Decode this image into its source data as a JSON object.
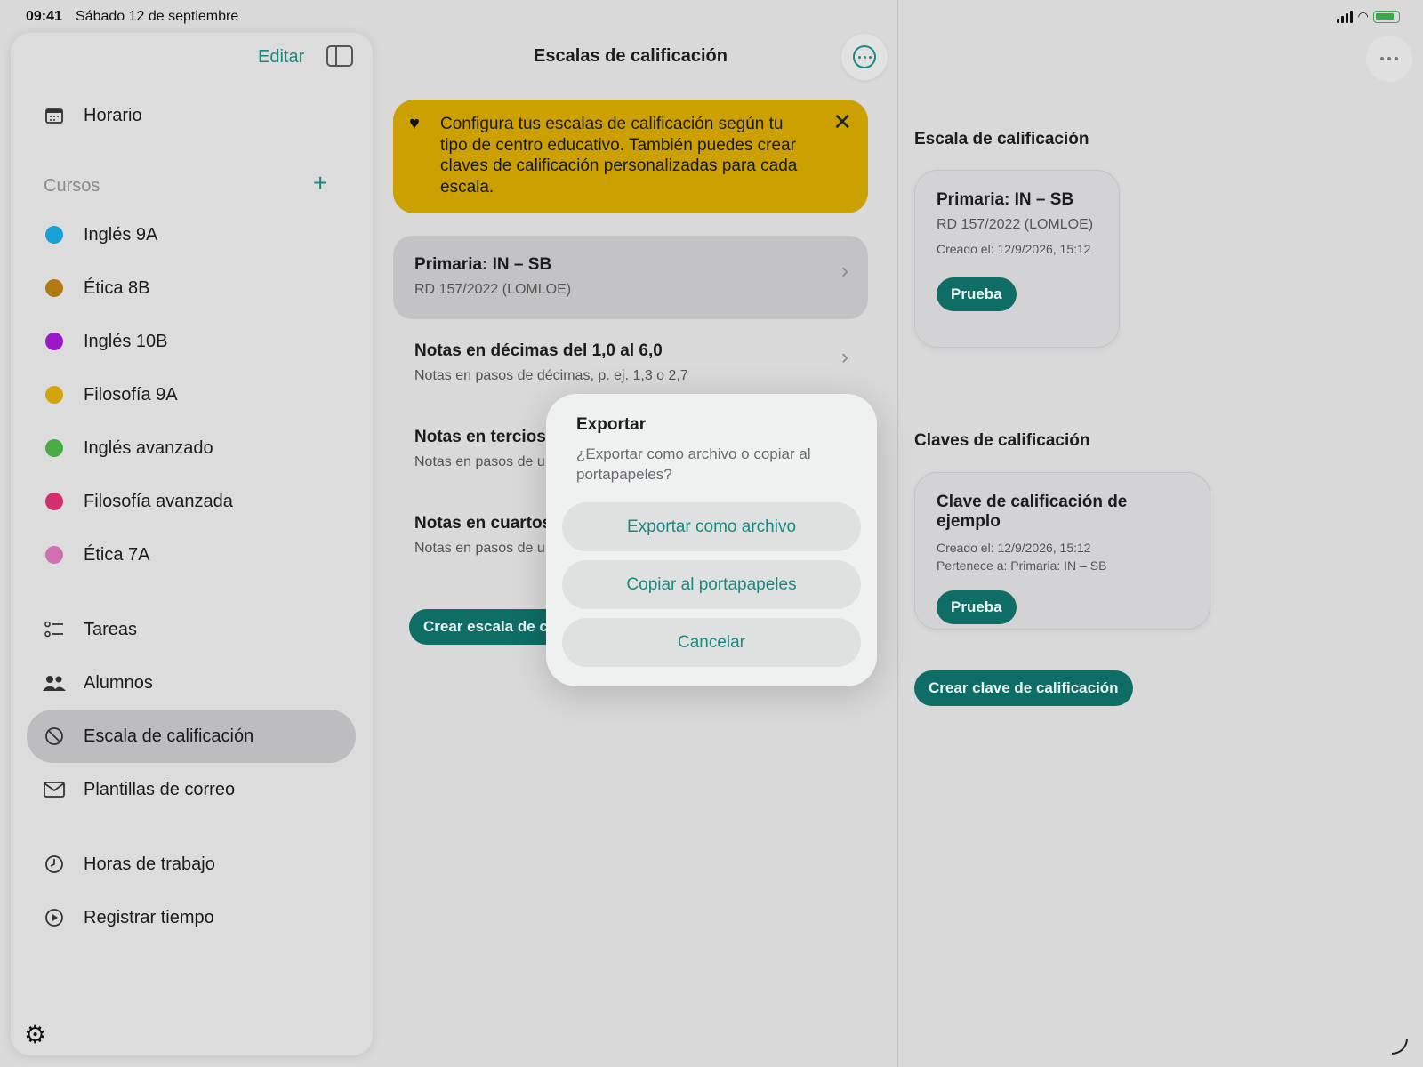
{
  "status": {
    "time": "09:41",
    "date": "Sábado 12 de septiembre"
  },
  "sidebar": {
    "edit_label": "Editar",
    "top_items": [
      {
        "label": "Horario",
        "icon": "calendar-icon"
      }
    ],
    "courses_title": "Cursos",
    "courses": [
      {
        "label": "Inglés 9A",
        "color": "#1aa0d8"
      },
      {
        "label": "Ética 8B",
        "color": "#b07a10"
      },
      {
        "label": "Inglés 10B",
        "color": "#9a18c8"
      },
      {
        "label": "Filosofía 9A",
        "color": "#d4a410"
      },
      {
        "label": "Inglés avanzado",
        "color": "#48ac44"
      },
      {
        "label": "Filosofía avanzada",
        "color": "#d0306e"
      },
      {
        "label": "Ética 7A",
        "color": "#d070b0"
      }
    ],
    "nav": [
      {
        "label": "Tareas",
        "icon": "checklist-icon"
      },
      {
        "label": "Alumnos",
        "icon": "people-icon"
      },
      {
        "label": "Escala de calificación",
        "icon": "grading-icon",
        "active": true
      },
      {
        "label": "Plantillas de correo",
        "icon": "mail-icon"
      }
    ],
    "time_items": [
      {
        "label": "Horas de trabajo",
        "icon": "clock-icon"
      },
      {
        "label": "Registrar tiempo",
        "icon": "play-circle-icon"
      }
    ]
  },
  "middle": {
    "title": "Escalas de calificación",
    "banner": "Configura tus escalas de calificación según tu tipo de centro educativo. También puedes crear claves de calificación personalizadas para cada escala.",
    "scales": [
      {
        "title": "Primaria: IN – SB",
        "subtitle": "RD 157/2022 (LOMLOE)"
      },
      {
        "title": "Notas en décimas del 1,0 al 6,0",
        "subtitle": "Notas en pasos de décimas, p. ej. 1,3 o 2,7"
      },
      {
        "title": "Notas en tercios",
        "subtitle": "Notas en pasos de u"
      },
      {
        "title": "Notas en cuartos",
        "subtitle": "Notas en pasos de u"
      }
    ],
    "create_label": "Crear escala de c"
  },
  "right": {
    "scale_section": "Escala de calificación",
    "scale_card": {
      "title": "Primaria: IN – SB",
      "subtitle": "RD 157/2022 (LOMLOE)",
      "created": "Creado el: 12/9/2026, 15:12",
      "button": "Prueba"
    },
    "keys_section": "Claves de calificación",
    "key_card": {
      "title": "Clave de calificación de ejemplo",
      "created": "Creado el: 12/9/2026, 15:12",
      "belongs": "Pertenece a: Primaria: IN – SB",
      "button": "Prueba"
    },
    "create_key_label": "Crear clave de calificación"
  },
  "dialog": {
    "title": "Exportar",
    "message": "¿Exportar como archivo o copiar al portapapeles?",
    "export_file": "Exportar como archivo",
    "copy_clipboard": "Copiar al portapapeles",
    "cancel": "Cancelar"
  },
  "colors": {
    "accent": "#1a8a80",
    "button_dark": "#0e6e66",
    "banner": "#cba000"
  }
}
